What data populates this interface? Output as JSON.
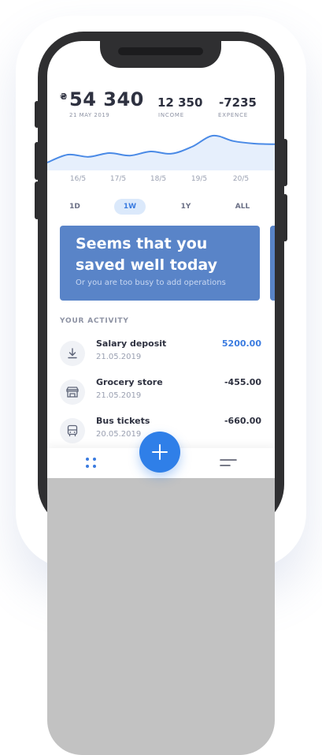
{
  "summary": {
    "currency_symbol": "₴",
    "balance": "54 340",
    "date": "21 MAY 2019",
    "income_value": "12 350",
    "income_label": "INCOME",
    "expense_value": "-7235",
    "expense_label": "EXPENCE"
  },
  "chart_data": {
    "type": "area",
    "x": [
      "16/5",
      "17/5",
      "18/5",
      "19/5",
      "20/5"
    ],
    "title": "",
    "xlabel": "",
    "ylabel": "",
    "grid": false,
    "series": [
      {
        "values": [
          0.1,
          0.35,
          0.28,
          0.4,
          0.32,
          0.45,
          0.38,
          0.6,
          0.95,
          0.78,
          0.7,
          0.68
        ]
      }
    ],
    "colors": {
      "line": "#4a8ae6",
      "fill": "#e6effc"
    }
  },
  "ranges": [
    "1D",
    "1W",
    "1Y",
    "ALL"
  ],
  "active_range": "1W",
  "banner": {
    "title": "Seems that you saved well today",
    "subtitle": "Or you are too busy to add operations"
  },
  "activity": {
    "heading": "YOUR ACTIVITY",
    "items": [
      {
        "name": "Salary deposit",
        "date": "21.05.2019",
        "amount": "5200.00",
        "icon": "download-icon",
        "positive": true
      },
      {
        "name": "Grocery store",
        "date": "21.05.2019",
        "amount": "-455.00",
        "icon": "store-icon",
        "positive": false
      },
      {
        "name": "Bus tickets",
        "date": "20.05.2019",
        "amount": "-660.00",
        "icon": "bus-icon",
        "positive": false
      }
    ]
  },
  "nav": {
    "left_icon": "dashboard-dots-icon",
    "fab_icon": "plus-icon",
    "right_icon": "menu-lines-icon"
  },
  "colors": {
    "accent": "#2f7fe8",
    "banner": "#5984c8",
    "positive": "#3a7be0"
  }
}
